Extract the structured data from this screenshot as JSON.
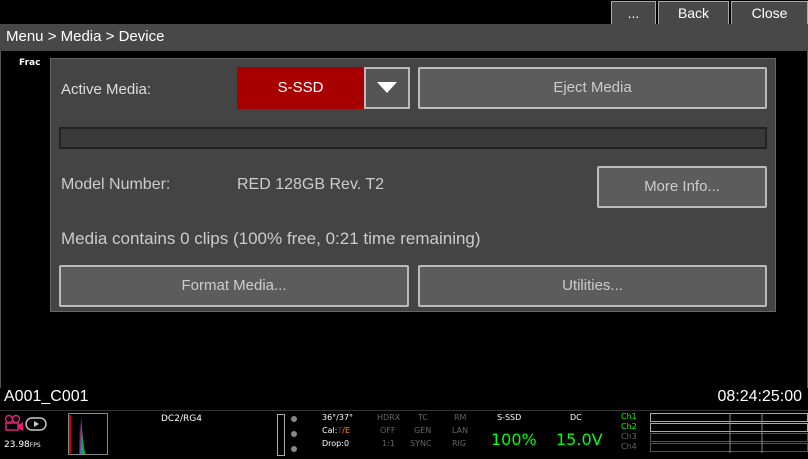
{
  "header": {
    "breadcrumb": "Menu > Media > Device",
    "more_label": "...",
    "back_label": "Back",
    "close_label": "Close"
  },
  "viewport": {
    "frac_label": "Frac"
  },
  "dialog": {
    "active_media_label": "Active Media:",
    "active_media_value": "S-SSD",
    "eject_label": "Eject Media",
    "model_label": "Model Number:",
    "model_value": "RED 128GB Rev. T2",
    "more_info_label": "More Info...",
    "media_status": "Media contains 0 clips (100% free, 0:21 time remaining)",
    "format_label": "Format Media...",
    "utilities_label": "Utilities...",
    "storage_used_fraction": 0
  },
  "clip": {
    "name": "A001_C001",
    "timecode": "08:24:25:00"
  },
  "status": {
    "fps": "23.98",
    "fps_unit": "FPS",
    "color_mode": "DC2/RG4",
    "shutter": "36°/37°",
    "cal": "Cal:",
    "cal_t": "T",
    "cal_e": "/E",
    "drop": "Drop:0",
    "hdrx_top": "HDRX",
    "hdrx_mid": "OFF",
    "hdrx_bot": "1:1",
    "tc_top": "TC",
    "tc_mid": "GEN",
    "tc_bot": "SYNC",
    "rm_top": "RM",
    "rm_mid": "LAN",
    "rm_bot": "RIG",
    "media_label": "S-SSD",
    "media_value": "100%",
    "power_label": "DC",
    "power_value": "15.0V",
    "ch1": "Ch1",
    "ch2": "Ch2",
    "ch3": "Ch3",
    "ch4": "Ch4"
  },
  "colors": {
    "accent_red": "#a80000",
    "status_green": "#00ff00",
    "panel_gray": "#444444"
  }
}
